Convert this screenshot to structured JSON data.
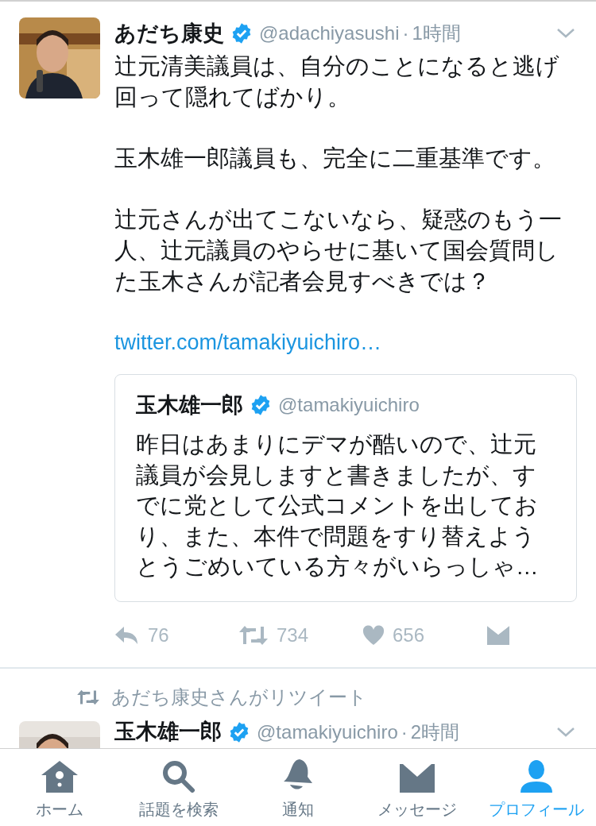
{
  "tweets": [
    {
      "author": {
        "name": "あだち康史",
        "verified": true,
        "handle": "@adachiyasushi",
        "separator": "·",
        "time": "1時間"
      },
      "paragraphs": [
        "辻元清美議員は、自分のことになると逃げ回って隠れてばかり。",
        "玉木雄一郎議員も、完全に二重基準です。",
        "辻元さんが出てこないなら、疑惑のもう一人、辻元議員のやらせに基いて国会質問した玉木さんが記者会見すべきでは？"
      ],
      "link": "twitter.com/tamakiyuichiro…",
      "quote": {
        "name": "玉木雄一郎",
        "verified": true,
        "handle": "@tamakiyuichiro",
        "text": "昨日はあまりにデマが酷いので、辻元議員が会見しますと書きましたが、すでに党として公式コメントを出しており、また、本件で問題をすり替えようとうごめいている方々がいらっしゃ…"
      },
      "actions": [
        {
          "kind": "reply",
          "count": "76"
        },
        {
          "kind": "retweet",
          "count": "734"
        },
        {
          "kind": "like",
          "count": "656"
        },
        {
          "kind": "message"
        }
      ]
    },
    {
      "retweeted_by": "あだち康史さんがリツイート",
      "author": {
        "name": "玉木雄一郎",
        "verified": true,
        "handle": "@tamakiyuichiro",
        "separator": "·",
        "time": "2時間"
      }
    }
  ],
  "tab_bar": [
    {
      "kind": "home",
      "label": "ホーム",
      "selected": false
    },
    {
      "kind": "search",
      "label": "話題を検索",
      "selected": false
    },
    {
      "kind": "notifications",
      "label": "通知",
      "selected": false
    },
    {
      "kind": "messages",
      "label": "メッセージ",
      "selected": false
    },
    {
      "kind": "profile",
      "label": "プロフィール",
      "selected": true
    }
  ]
}
